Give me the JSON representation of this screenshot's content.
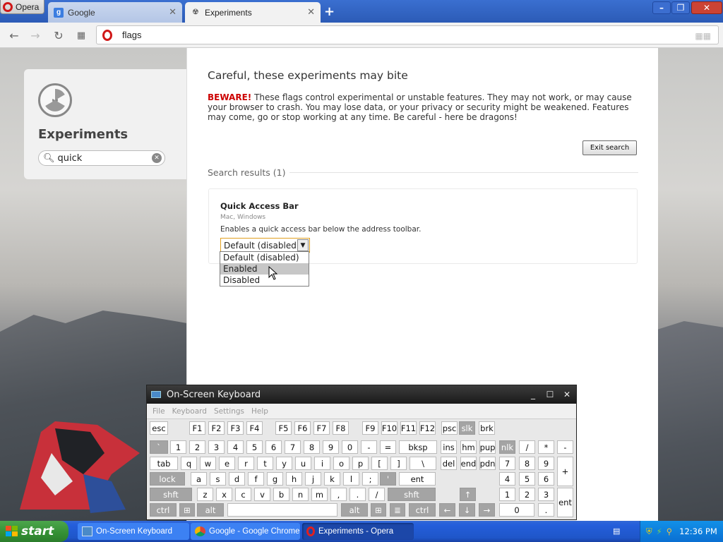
{
  "browser": {
    "menu_label": "Opera",
    "tabs": [
      {
        "label": "Google"
      },
      {
        "label": "Experiments"
      }
    ],
    "address": "flags"
  },
  "sidebar": {
    "title": "Experiments",
    "search_value": "quick"
  },
  "main": {
    "heading": "Careful, these experiments may bite",
    "warning_lead": "BEWARE!",
    "warning_text": " These flags control experimental or unstable features. They may not work, or may cause your browser to crash. You may lose data, or your privacy or security might be weakened. Features may come, go or stop working at any time. Be careful - here be dragons!",
    "exit_search_label": "Exit search",
    "results_label": "Search results (1)",
    "flag": {
      "name": "Quick Access Bar",
      "platforms": "Mac, Windows",
      "description": "Enables a quick access bar below the address toolbar.",
      "selected": "Default (disabled)",
      "options": [
        "Default (disabled)",
        "Enabled",
        "Disabled"
      ],
      "highlighted_option": "Enabled"
    }
  },
  "osk": {
    "title": "On-Screen Keyboard",
    "menu": [
      "File",
      "Keyboard",
      "Settings",
      "Help"
    ],
    "rows": {
      "fn": [
        "esc",
        "F1",
        "F2",
        "F3",
        "F4",
        "F5",
        "F6",
        "F7",
        "F8",
        "F9",
        "F10",
        "F11",
        "F12",
        "psc",
        "slk",
        "brk"
      ],
      "num": [
        "`",
        "1",
        "2",
        "3",
        "4",
        "5",
        "6",
        "7",
        "8",
        "9",
        "0",
        "-",
        "=",
        "bksp",
        "ins",
        "hm",
        "pup",
        "nlk",
        "/",
        "*",
        "-"
      ],
      "tab": [
        "tab",
        "q",
        "w",
        "e",
        "r",
        "t",
        "y",
        "u",
        "i",
        "o",
        "p",
        "[",
        "]",
        "\\",
        "del",
        "end",
        "pdn",
        "7",
        "8",
        "9",
        "+"
      ],
      "caps": [
        "lock",
        "a",
        "s",
        "d",
        "f",
        "g",
        "h",
        "j",
        "k",
        "l",
        ";",
        "'",
        "ent",
        "4",
        "5",
        "6"
      ],
      "shift": [
        "shft",
        "z",
        "x",
        "c",
        "v",
        "b",
        "n",
        "m",
        ",",
        ".",
        "/",
        "shft",
        "1",
        "2",
        "3",
        "ent"
      ],
      "ctrl": [
        "ctrl",
        "alt",
        "alt",
        "ctrl",
        "0",
        "."
      ]
    }
  },
  "taskbar": {
    "start_label": "start",
    "tasks": [
      "On-Screen Keyboard",
      "Google - Google Chrome",
      "Experiments - Opera"
    ],
    "clock": "12:36 PM"
  }
}
